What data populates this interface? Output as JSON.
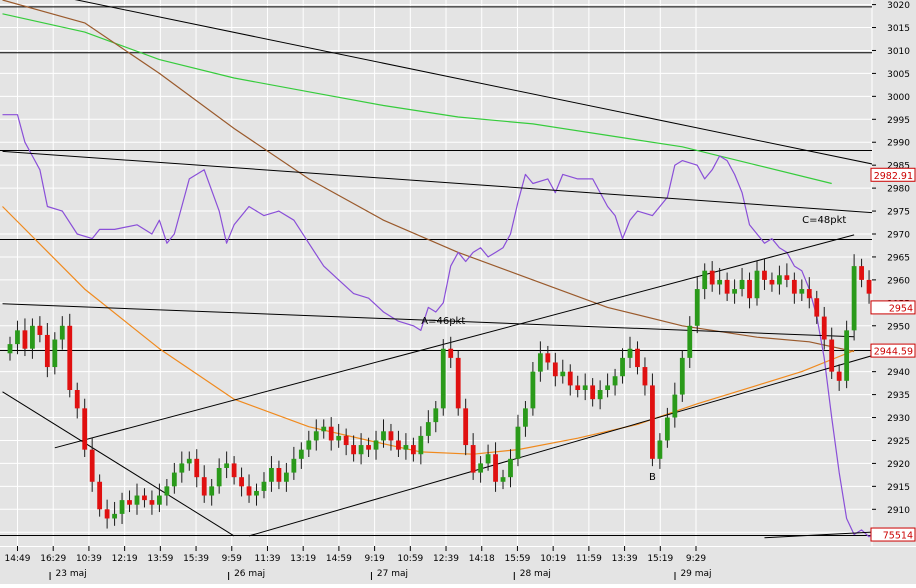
{
  "chart_data": {
    "type": "candlestick",
    "colors": {
      "background": "#e4e4e4",
      "bull": "#2a9a1a",
      "bear": "#e01010",
      "oscillator": "#8a4fd8",
      "ma_long": "#36cc3c",
      "ma_mid": "#9a5a2c",
      "ma_short": "#f08a1e",
      "lines": "#000000",
      "badge_text": "#cc0000"
    },
    "y_axis": {
      "ticks": [
        2905,
        2910,
        2915,
        2920,
        2925,
        2930,
        2935,
        2940,
        2945,
        2950,
        2955,
        2960,
        2965,
        2970,
        2975,
        2980,
        2985,
        2990,
        2995,
        3000,
        3005,
        3010,
        3015,
        3020
      ],
      "ylim": [
        2902,
        3021
      ]
    },
    "x_axis": {
      "time_labels": [
        "14:49",
        "16:29",
        "10:39",
        "12:19",
        "13:59",
        "15:39",
        "9:59",
        "11:39",
        "13:19",
        "14:59",
        "9:19",
        "10:59",
        "12:39",
        "14:18",
        "15:59",
        "10:19",
        "11:59",
        "13:39",
        "15:19",
        "9:29"
      ],
      "date_labels": [
        "23 maj",
        "26 maj",
        "27 maj",
        "28 maj",
        "29 maj"
      ],
      "bar_count": 116
    },
    "price_badges": [
      {
        "text": "2982.91",
        "value": 2982.91
      },
      {
        "text": "2954",
        "value": 2954
      },
      {
        "text": "2944.59",
        "value": 2944.59
      },
      {
        "text": "75514",
        "value": 2904.5
      }
    ],
    "annotations": [
      {
        "text": "A=46pkt",
        "bar": 58,
        "value": 2951
      },
      {
        "text": "B",
        "bar": 86,
        "value": 2917
      },
      {
        "text": "C=48pkt",
        "bar": 109,
        "value": 2973
      }
    ],
    "horizontal_levels": [
      3019.5,
      3009.5,
      2988.2,
      2968.8,
      2944.6,
      2904.3
    ],
    "trend_lines": [
      {
        "x1": -1,
        "y1": 2954.8,
        "x2": 113,
        "y2": 2947.6
      },
      {
        "x1": 6,
        "y1": 2923.4,
        "x2": 113,
        "y2": 2969.8
      },
      {
        "x1": 32,
        "y1": 2904.2,
        "x2": 125,
        "y2": 2948.0
      },
      {
        "x1": -1,
        "y1": 2935.6,
        "x2": 30,
        "y2": 2904.2
      },
      {
        "x1": 6,
        "y1": 3022.0,
        "x2": 143,
        "y2": 2976.0
      },
      {
        "x1": -1,
        "y1": 2988.0,
        "x2": 143,
        "y2": 2971.5
      },
      {
        "x1": 101,
        "y1": 2903.8,
        "x2": 143,
        "y2": 2907.4
      }
    ],
    "close": [
      2946,
      2949,
      2945,
      2950,
      2948,
      2941,
      2947,
      2950,
      2936,
      2932,
      2923,
      2916,
      2910,
      2908,
      2909,
      2912,
      2911,
      2913,
      2912,
      2911,
      2913,
      2915,
      2918,
      2920,
      2921,
      2917,
      2913,
      2915,
      2919,
      2920,
      2917,
      2915,
      2913,
      2914,
      2916,
      2919,
      2916,
      2918,
      2921,
      2923,
      2925,
      2927,
      2928,
      2925,
      2926,
      2924,
      2922,
      2924,
      2923,
      2925,
      2927,
      2925,
      2923,
      2924,
      2922,
      2926,
      2929,
      2932,
      2945,
      2943,
      2932,
      2924,
      2918,
      2920,
      2922,
      2916,
      2917,
      2921,
      2928,
      2932,
      2940,
      2944,
      2942,
      2939,
      2940,
      2937,
      2936,
      2937,
      2934,
      2936,
      2937,
      2939,
      2943,
      2945,
      2941,
      2937,
      2921,
      2925,
      2930,
      2935,
      2943,
      2950,
      2958,
      2962,
      2959,
      2960,
      2957,
      2958,
      2960,
      2956,
      2962,
      2960,
      2959,
      2961,
      2960,
      2957,
      2958,
      2956,
      2952,
      2947,
      2940,
      2938,
      2949,
      2963,
      2960,
      2957,
      2958,
      2955
    ],
    "ma_long": [
      [
        -1,
        3018
      ],
      [
        10,
        3014
      ],
      [
        20,
        3008
      ],
      [
        30,
        3004
      ],
      [
        40,
        3001
      ],
      [
        50,
        2998
      ],
      [
        60,
        2995.5
      ],
      [
        70,
        2994
      ],
      [
        80,
        2991.5
      ],
      [
        90,
        2989
      ],
      [
        100,
        2985
      ],
      [
        110,
        2981
      ]
    ],
    "ma_mid": [
      [
        -1,
        3021
      ],
      [
        10,
        3016
      ],
      [
        20,
        3005
      ],
      [
        30,
        2993
      ],
      [
        40,
        2982
      ],
      [
        50,
        2973
      ],
      [
        60,
        2966
      ],
      [
        70,
        2960
      ],
      [
        80,
        2954
      ],
      [
        90,
        2950
      ],
      [
        100,
        2947.5
      ],
      [
        107,
        2946.5
      ],
      [
        113,
        2944.4
      ]
    ],
    "ma_short": [
      [
        -1,
        2976
      ],
      [
        10,
        2958
      ],
      [
        20,
        2945
      ],
      [
        30,
        2934
      ],
      [
        40,
        2928
      ],
      [
        48,
        2925
      ],
      [
        55,
        2922.5
      ],
      [
        62,
        2922
      ],
      [
        68,
        2923
      ],
      [
        76,
        2925.5
      ],
      [
        84,
        2928.5
      ],
      [
        92,
        2933
      ],
      [
        100,
        2937
      ],
      [
        106,
        2940
      ],
      [
        113,
        2944.6
      ]
    ],
    "oscillator": [
      [
        -1,
        2996
      ],
      [
        1,
        2996
      ],
      [
        2,
        2990
      ],
      [
        3,
        2987
      ],
      [
        4,
        2984
      ],
      [
        5,
        2976
      ],
      [
        7,
        2975
      ],
      [
        9,
        2970
      ],
      [
        11,
        2969
      ],
      [
        12,
        2971
      ],
      [
        14,
        2971
      ],
      [
        17,
        2972
      ],
      [
        19,
        2970
      ],
      [
        20,
        2973
      ],
      [
        21,
        2968
      ],
      [
        22,
        2970
      ],
      [
        24,
        2982
      ],
      [
        26,
        2984
      ],
      [
        28,
        2975
      ],
      [
        29,
        2968
      ],
      [
        30,
        2972
      ],
      [
        32,
        2976
      ],
      [
        34,
        2974
      ],
      [
        36,
        2975
      ],
      [
        38,
        2973
      ],
      [
        40,
        2968
      ],
      [
        42,
        2963
      ],
      [
        44,
        2960
      ],
      [
        46,
        2957
      ],
      [
        48,
        2956
      ],
      [
        50,
        2953
      ],
      [
        52,
        2951
      ],
      [
        54,
        2950
      ],
      [
        55,
        2949
      ],
      [
        56,
        2954
      ],
      [
        57,
        2953
      ],
      [
        58,
        2955
      ],
      [
        59,
        2963
      ],
      [
        60,
        2966
      ],
      [
        61,
        2964
      ],
      [
        62,
        2966
      ],
      [
        63,
        2967
      ],
      [
        64,
        2965
      ],
      [
        65,
        2966
      ],
      [
        66,
        2967
      ],
      [
        67,
        2970
      ],
      [
        68,
        2977
      ],
      [
        69,
        2983
      ],
      [
        70,
        2981
      ],
      [
        72,
        2982
      ],
      [
        73,
        2979
      ],
      [
        74,
        2983
      ],
      [
        76,
        2982
      ],
      [
        78,
        2982
      ],
      [
        80,
        2976
      ],
      [
        81,
        2974
      ],
      [
        82,
        2969
      ],
      [
        83,
        2973
      ],
      [
        84,
        2975
      ],
      [
        86,
        2974
      ],
      [
        88,
        2978
      ],
      [
        89,
        2985
      ],
      [
        90,
        2986
      ],
      [
        92,
        2985
      ],
      [
        93,
        2982
      ],
      [
        94,
        2984
      ],
      [
        95,
        2987
      ],
      [
        96,
        2986
      ],
      [
        97,
        2983
      ],
      [
        98,
        2979
      ],
      [
        99,
        2972
      ],
      [
        100,
        2970
      ],
      [
        101,
        2968
      ],
      [
        102,
        2969
      ],
      [
        103,
        2967
      ],
      [
        104,
        2966
      ],
      [
        105,
        2963
      ],
      [
        106,
        2962
      ],
      [
        107,
        2958
      ],
      [
        108,
        2952
      ],
      [
        109,
        2943
      ],
      [
        110,
        2930
      ],
      [
        111,
        2918
      ],
      [
        112,
        2908
      ],
      [
        113,
        2904.5
      ],
      [
        114,
        2905.5
      ],
      [
        115,
        2904
      ],
      [
        116,
        2905
      ],
      [
        117,
        2903.5
      ]
    ]
  }
}
